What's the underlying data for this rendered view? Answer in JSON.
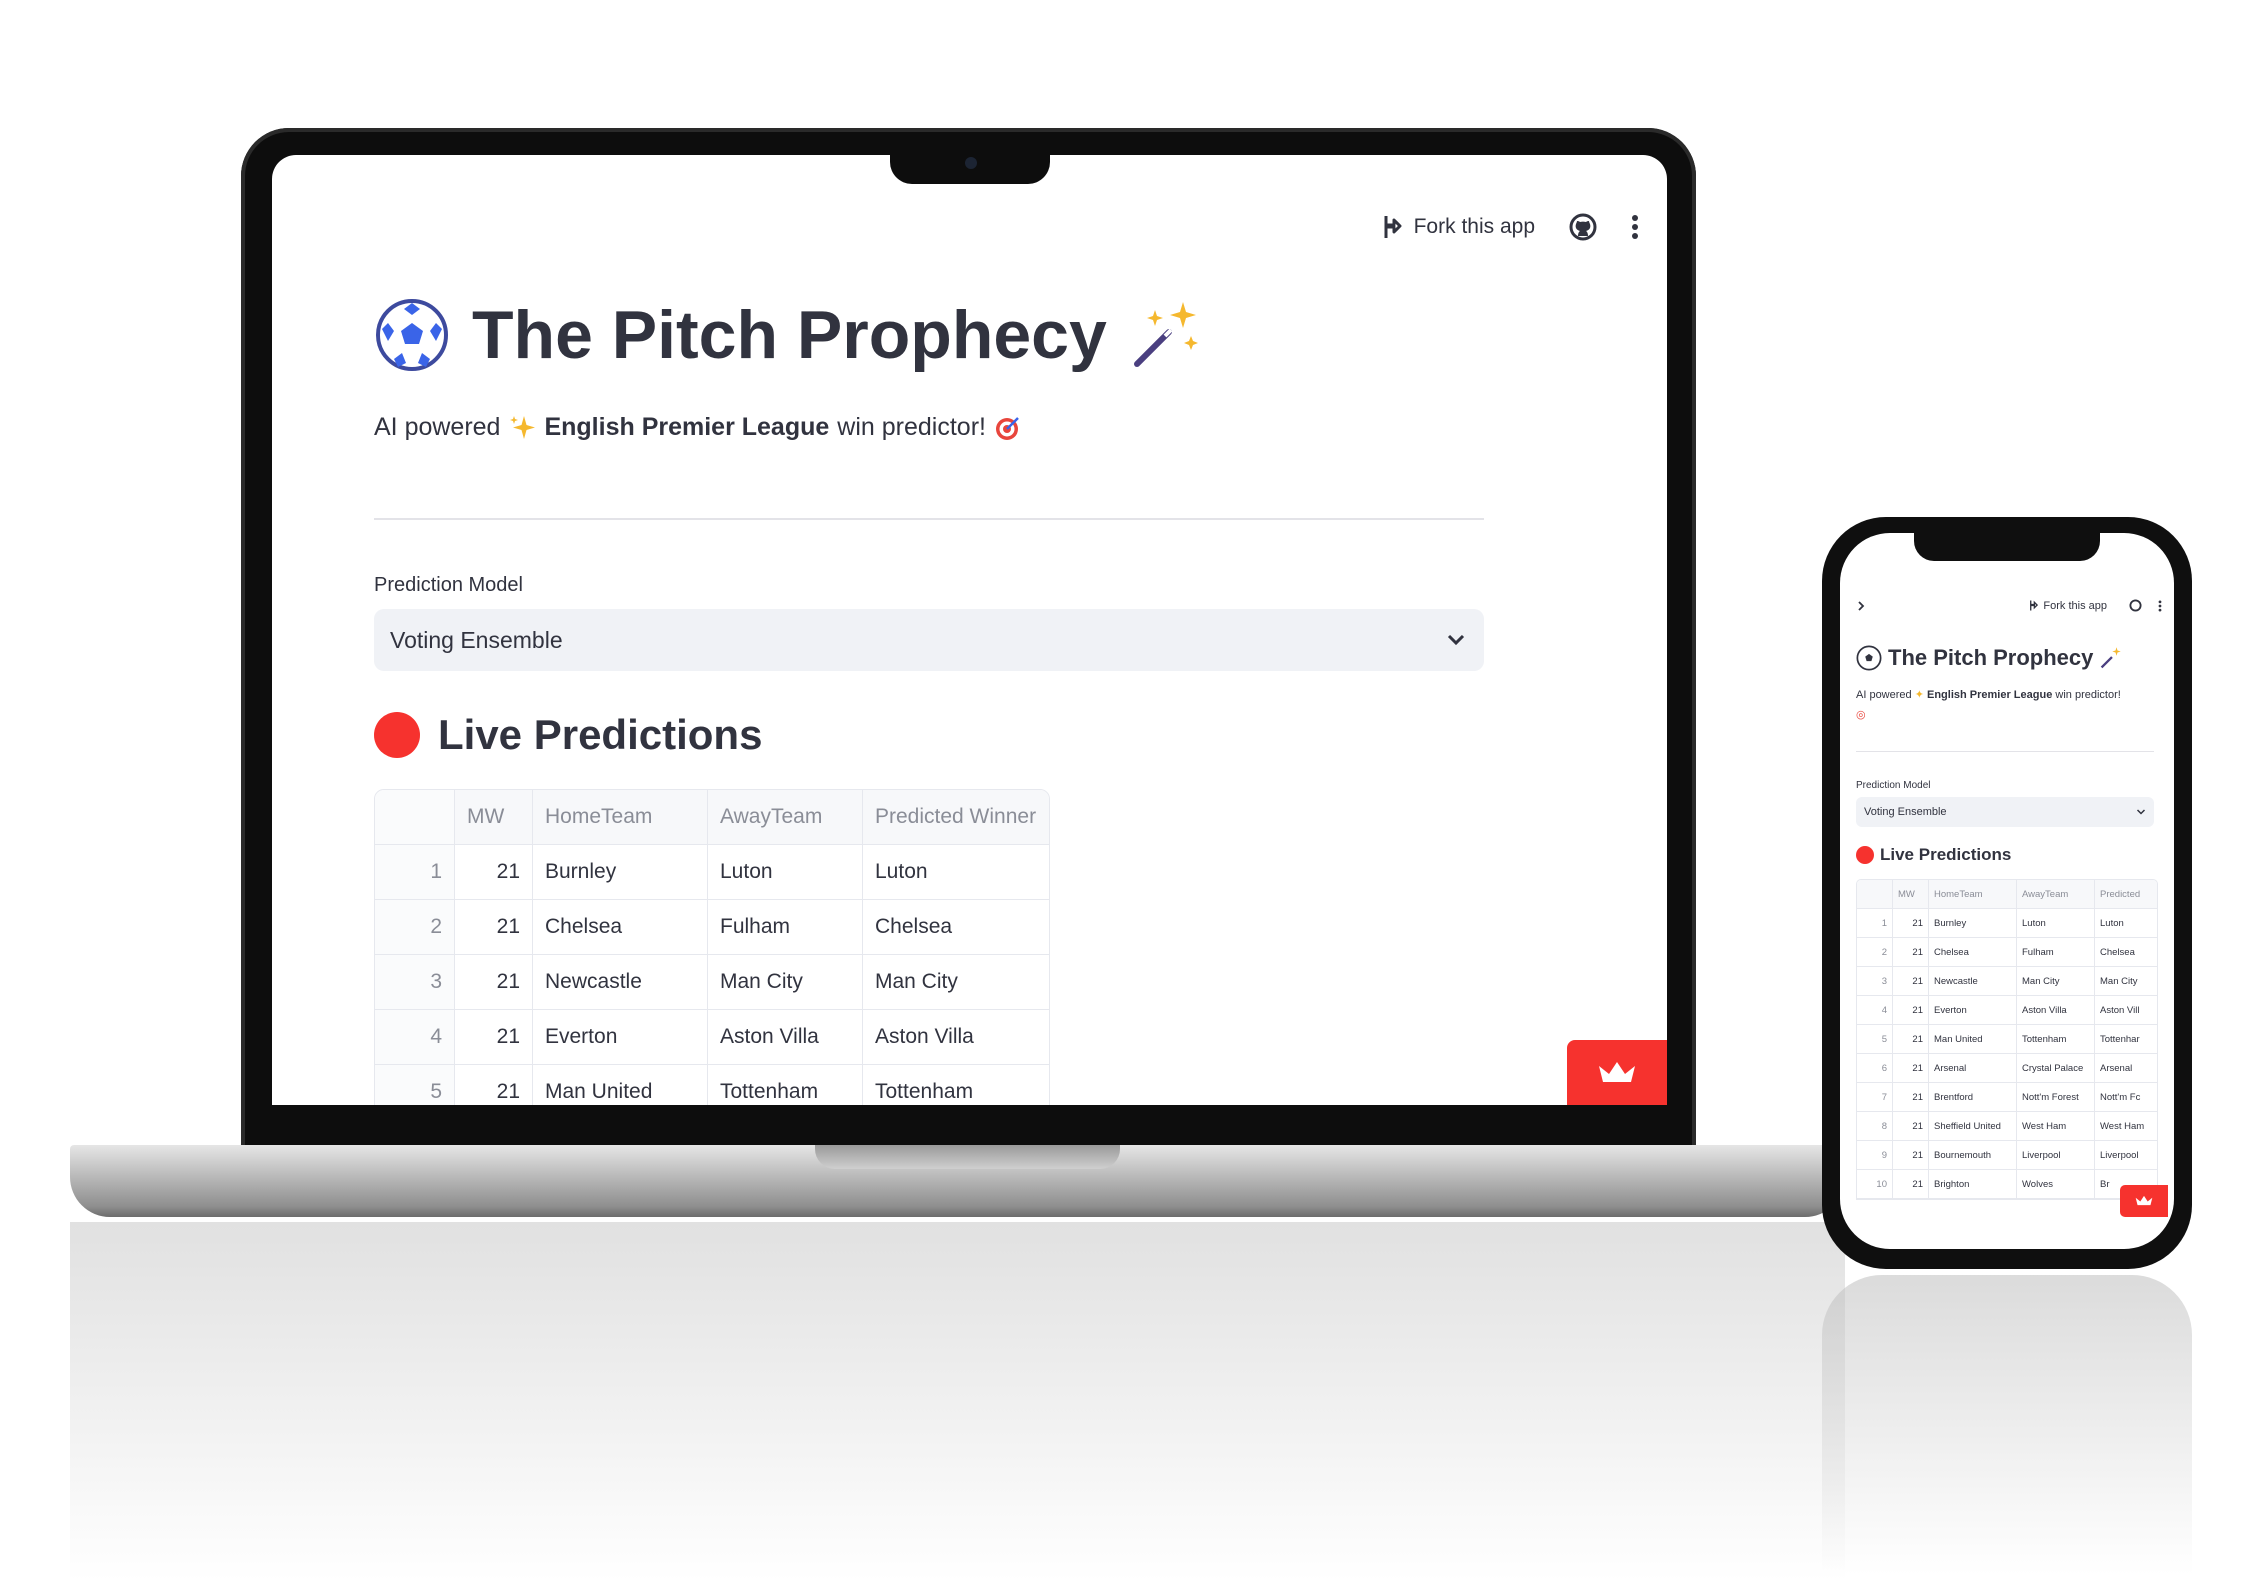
{
  "app": {
    "title": "The Pitch Prophecy",
    "title_icon": "soccer-ball-icon",
    "title_suffix_icon": "magic-wand-icon",
    "subtitle_prefix": "AI powered",
    "subtitle_bold": "English Premier League",
    "subtitle_suffix": "win predictor!",
    "toolbar": {
      "fork_label": "Fork this app",
      "github_icon": "github-icon",
      "menu_icon": "kebab-menu-icon"
    },
    "prediction_model_label": "Prediction Model",
    "prediction_model_value": "Voting Ensemble",
    "live_section_title": "Live Predictions",
    "colors": {
      "accent_red": "#f6322e",
      "text": "#31333f",
      "select_bg": "#f0f2f6"
    }
  },
  "table": {
    "columns": [
      "MW",
      "HomeTeam",
      "AwayTeam",
      "Predicted Winner"
    ],
    "rows": [
      {
        "idx": "1",
        "mw": "21",
        "home": "Burnley",
        "away": "Luton",
        "winner": "Luton"
      },
      {
        "idx": "2",
        "mw": "21",
        "home": "Chelsea",
        "away": "Fulham",
        "winner": "Chelsea"
      },
      {
        "idx": "3",
        "mw": "21",
        "home": "Newcastle",
        "away": "Man City",
        "winner": "Man City"
      },
      {
        "idx": "4",
        "mw": "21",
        "home": "Everton",
        "away": "Aston Villa",
        "winner": "Aston Villa"
      },
      {
        "idx": "5",
        "mw": "21",
        "home": "Man United",
        "away": "Tottenham",
        "winner": "Tottenham"
      },
      {
        "idx": "6",
        "mw": "21",
        "home": "Arsenal",
        "away": "Crystal Palace",
        "winner": "Arsenal"
      },
      {
        "idx": "7",
        "mw": "21",
        "home": "Brentford",
        "away": "Nott'm Forest",
        "winner": "Nott'm Fc"
      },
      {
        "idx": "8",
        "mw": "21",
        "home": "Sheffield United",
        "away": "West Ham",
        "winner": "West Ham"
      },
      {
        "idx": "9",
        "mw": "21",
        "home": "Bournemouth",
        "away": "Liverpool",
        "winner": "Liverpool"
      },
      {
        "idx": "10",
        "mw": "21",
        "home": "Brighton",
        "away": "Wolves",
        "winner": "Br"
      }
    ],
    "phone_winner_header": "Predicted",
    "phone_row_winners": [
      "Luton",
      "Chelsea",
      "Man City",
      "Aston Vill",
      "Tottenhar",
      "Arsenal",
      "Nott'm Fc",
      "West Ham",
      "Liverpool",
      "Br"
    ]
  }
}
